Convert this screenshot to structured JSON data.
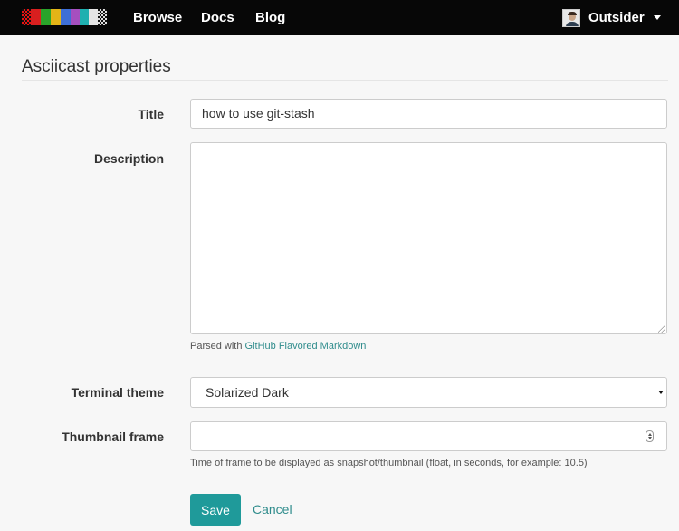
{
  "navbar": {
    "logo_colors": [
      "#ffffff",
      "#d81f1f",
      "#2aa32a",
      "#e3b417",
      "#3e6fd6",
      "#a64fbf",
      "#1fb0b0",
      "#e4e4e4"
    ],
    "links": [
      "Browse",
      "Docs",
      "Blog"
    ],
    "user": {
      "name": "Outsider"
    }
  },
  "page": {
    "title": "Asciicast properties"
  },
  "form": {
    "title": {
      "label": "Title",
      "value": "how to use git-stash"
    },
    "description": {
      "label": "Description",
      "value": "",
      "help_prefix": "Parsed with ",
      "help_link": "GitHub Flavored Markdown"
    },
    "terminal_theme": {
      "label": "Terminal theme",
      "selected": "Solarized Dark"
    },
    "thumbnail_frame": {
      "label": "Thumbnail frame",
      "value": "",
      "help": "Time of frame to be displayed as snapshot/thumbnail (float, in seconds, for example: 10.5)"
    },
    "save_label": "Save",
    "cancel_label": "Cancel"
  },
  "colors": {
    "navbar_bg": "#070707",
    "accent": "#1f9a9a",
    "link": "#2f8c8c"
  }
}
